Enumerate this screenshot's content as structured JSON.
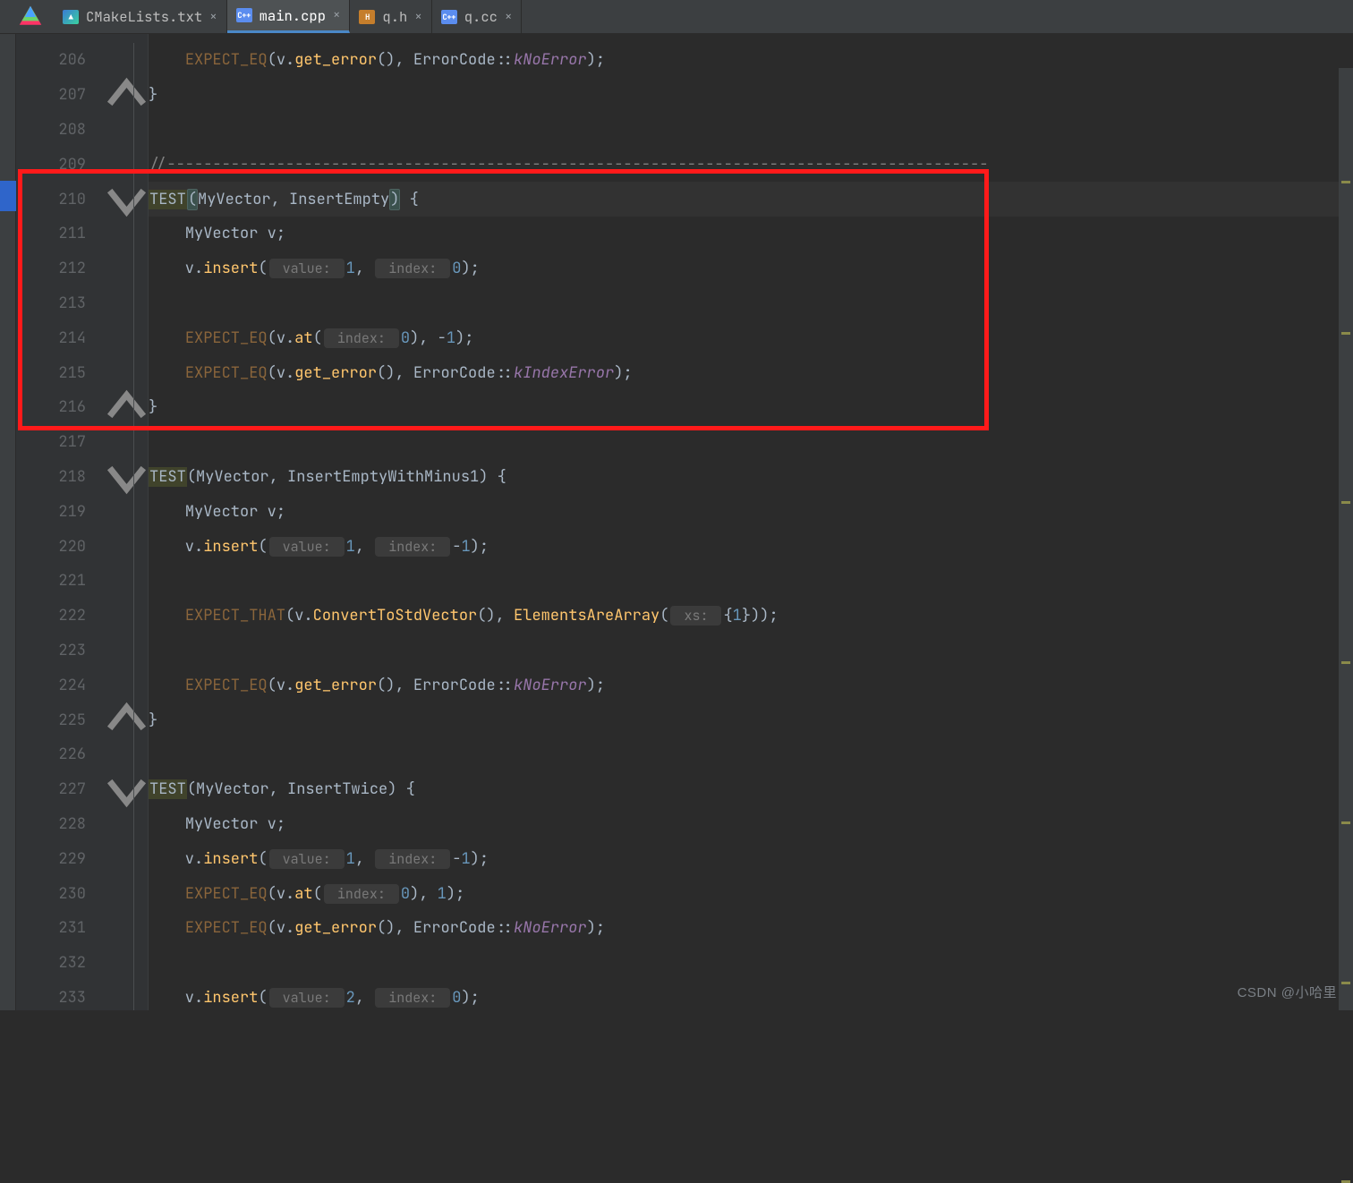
{
  "tabs": [
    {
      "label": "CMakeLists.txt",
      "ico": "cmake",
      "active": false
    },
    {
      "label": "main.cpp",
      "ico": "cpp",
      "active": true
    },
    {
      "label": "q.h",
      "ico": "h",
      "active": false
    },
    {
      "label": "q.cc",
      "ico": "cpp",
      "active": false
    }
  ],
  "first_line_no": 206,
  "code_lines": [
    {
      "n": 206,
      "fold": "",
      "run": false,
      "tokens": [
        [
          "    ",
          ""
        ],
        [
          "EXPECT_EQ",
          "mac"
        ],
        [
          "(v.",
          ""
        ],
        [
          "get_error",
          "fn"
        ],
        [
          "(), ",
          ""
        ],
        [
          "ErrorCode",
          "ns"
        ],
        [
          "::",
          ""
        ],
        [
          "kNoError",
          "enum"
        ],
        [
          ")",
          ""
        ],
        [
          ";",
          ""
        ]
      ]
    },
    {
      "n": 207,
      "fold": "close",
      "run": false,
      "tokens": [
        [
          "}",
          ""
        ]
      ]
    },
    {
      "n": 208,
      "fold": "",
      "run": false,
      "tokens": []
    },
    {
      "n": 209,
      "fold": "",
      "run": false,
      "tokens": [
        [
          "//------------------------------------------------------------------------------------------",
          "cmt"
        ]
      ]
    },
    {
      "n": 210,
      "fold": "open",
      "run": true,
      "tokens": [
        [
          "TEST",
          "test-hl"
        ],
        [
          "(",
          "caret-bracket"
        ],
        [
          "MyVector",
          "id"
        ],
        [
          ", ",
          ""
        ],
        [
          "InsertEmpty",
          "id"
        ],
        [
          ")",
          "caret-bracket"
        ],
        [
          " {",
          ""
        ]
      ]
    },
    {
      "n": 211,
      "fold": "",
      "run": false,
      "tokens": [
        [
          "    ",
          ""
        ],
        [
          "MyVector",
          "id"
        ],
        [
          " v",
          ""
        ],
        [
          ";",
          ""
        ]
      ]
    },
    {
      "n": 212,
      "fold": "",
      "run": false,
      "tokens": [
        [
          "    v.",
          ""
        ],
        [
          "insert",
          "fn"
        ],
        [
          "(",
          ""
        ],
        [
          " value: ",
          "hint"
        ],
        [
          "1",
          "num"
        ],
        [
          ", ",
          ""
        ],
        [
          " index: ",
          "hint"
        ],
        [
          "0",
          "num"
        ],
        [
          ")",
          ""
        ],
        [
          ";",
          ""
        ]
      ]
    },
    {
      "n": 213,
      "fold": "",
      "run": false,
      "tokens": []
    },
    {
      "n": 214,
      "fold": "",
      "run": false,
      "tokens": [
        [
          "    ",
          ""
        ],
        [
          "EXPECT_EQ",
          "mac"
        ],
        [
          "(v.",
          ""
        ],
        [
          "at",
          "fn"
        ],
        [
          "(",
          ""
        ],
        [
          " index: ",
          "hint"
        ],
        [
          "0",
          "num"
        ],
        [
          "), ",
          ""
        ],
        [
          "-",
          ""
        ],
        [
          "1",
          "num"
        ],
        [
          ")",
          ""
        ],
        [
          ";",
          ""
        ]
      ]
    },
    {
      "n": 215,
      "fold": "",
      "run": false,
      "tokens": [
        [
          "    ",
          ""
        ],
        [
          "EXPECT_EQ",
          "mac"
        ],
        [
          "(v.",
          ""
        ],
        [
          "get_error",
          "fn"
        ],
        [
          "(), ",
          ""
        ],
        [
          "ErrorCode",
          "ns"
        ],
        [
          "::",
          ""
        ],
        [
          "kIndexError",
          "enum"
        ],
        [
          ")",
          ""
        ],
        [
          ";",
          ""
        ]
      ]
    },
    {
      "n": 216,
      "fold": "close",
      "run": false,
      "tokens": [
        [
          "}",
          ""
        ]
      ]
    },
    {
      "n": 217,
      "fold": "",
      "run": false,
      "tokens": []
    },
    {
      "n": 218,
      "fold": "open",
      "run": true,
      "tokens": [
        [
          "TEST",
          "test-hl"
        ],
        [
          "(",
          ""
        ],
        [
          "MyVector",
          "id"
        ],
        [
          ", ",
          ""
        ],
        [
          "InsertEmptyWithMinus1",
          "id"
        ],
        [
          ") {",
          ""
        ]
      ]
    },
    {
      "n": 219,
      "fold": "",
      "run": false,
      "tokens": [
        [
          "    ",
          ""
        ],
        [
          "MyVector",
          "id"
        ],
        [
          " v",
          ""
        ],
        [
          ";",
          ""
        ]
      ]
    },
    {
      "n": 220,
      "fold": "",
      "run": false,
      "tokens": [
        [
          "    v.",
          ""
        ],
        [
          "insert",
          "fn"
        ],
        [
          "(",
          ""
        ],
        [
          " value: ",
          "hint"
        ],
        [
          "1",
          "num"
        ],
        [
          ", ",
          ""
        ],
        [
          " index: ",
          "hint"
        ],
        [
          "-",
          ""
        ],
        [
          "1",
          "num"
        ],
        [
          ")",
          ""
        ],
        [
          ";",
          ""
        ]
      ]
    },
    {
      "n": 221,
      "fold": "",
      "run": false,
      "tokens": []
    },
    {
      "n": 222,
      "fold": "",
      "run": false,
      "tokens": [
        [
          "    ",
          ""
        ],
        [
          "EXPECT_THAT",
          "mac"
        ],
        [
          "(v.",
          ""
        ],
        [
          "ConvertToStdVector",
          "fn"
        ],
        [
          "(), ",
          ""
        ],
        [
          "ElementsAreArray",
          "fn"
        ],
        [
          "(",
          ""
        ],
        [
          " xs: ",
          "hint"
        ],
        [
          "{",
          ""
        ],
        [
          "1",
          "num"
        ],
        [
          "}))",
          ""
        ],
        [
          ";",
          ""
        ]
      ]
    },
    {
      "n": 223,
      "fold": "",
      "run": false,
      "tokens": []
    },
    {
      "n": 224,
      "fold": "",
      "run": false,
      "tokens": [
        [
          "    ",
          ""
        ],
        [
          "EXPECT_EQ",
          "mac"
        ],
        [
          "(v.",
          ""
        ],
        [
          "get_error",
          "fn"
        ],
        [
          "(), ",
          ""
        ],
        [
          "ErrorCode",
          "ns"
        ],
        [
          "::",
          ""
        ],
        [
          "kNoError",
          "enum"
        ],
        [
          ")",
          ""
        ],
        [
          ";",
          ""
        ]
      ]
    },
    {
      "n": 225,
      "fold": "close",
      "run": false,
      "tokens": [
        [
          "}",
          ""
        ]
      ]
    },
    {
      "n": 226,
      "fold": "",
      "run": false,
      "tokens": []
    },
    {
      "n": 227,
      "fold": "open",
      "run": true,
      "tokens": [
        [
          "TEST",
          "test-hl"
        ],
        [
          "(",
          ""
        ],
        [
          "MyVector",
          "id"
        ],
        [
          ", ",
          ""
        ],
        [
          "InsertTwice",
          "id"
        ],
        [
          ") {",
          ""
        ]
      ]
    },
    {
      "n": 228,
      "fold": "",
      "run": false,
      "tokens": [
        [
          "    ",
          ""
        ],
        [
          "MyVector",
          "id"
        ],
        [
          " v",
          ""
        ],
        [
          ";",
          ""
        ]
      ]
    },
    {
      "n": 229,
      "fold": "",
      "run": false,
      "tokens": [
        [
          "    v.",
          ""
        ],
        [
          "insert",
          "fn"
        ],
        [
          "(",
          ""
        ],
        [
          " value: ",
          "hint"
        ],
        [
          "1",
          "num"
        ],
        [
          ", ",
          ""
        ],
        [
          " index: ",
          "hint"
        ],
        [
          "-",
          ""
        ],
        [
          "1",
          "num"
        ],
        [
          ")",
          ""
        ],
        [
          ";",
          ""
        ]
      ]
    },
    {
      "n": 230,
      "fold": "",
      "run": false,
      "tokens": [
        [
          "    ",
          ""
        ],
        [
          "EXPECT_EQ",
          "mac"
        ],
        [
          "(v.",
          ""
        ],
        [
          "at",
          "fn"
        ],
        [
          "(",
          ""
        ],
        [
          " index: ",
          "hint"
        ],
        [
          "0",
          "num"
        ],
        [
          "), ",
          ""
        ],
        [
          "1",
          "num"
        ],
        [
          ")",
          ""
        ],
        [
          ";",
          ""
        ]
      ]
    },
    {
      "n": 231,
      "fold": "",
      "run": false,
      "tokens": [
        [
          "    ",
          ""
        ],
        [
          "EXPECT_EQ",
          "mac"
        ],
        [
          "(v.",
          ""
        ],
        [
          "get_error",
          "fn"
        ],
        [
          "(), ",
          ""
        ],
        [
          "ErrorCode",
          "ns"
        ],
        [
          "::",
          ""
        ],
        [
          "kNoError",
          "enum"
        ],
        [
          ")",
          ""
        ],
        [
          ";",
          ""
        ]
      ]
    },
    {
      "n": 232,
      "fold": "",
      "run": false,
      "tokens": []
    },
    {
      "n": 233,
      "fold": "",
      "run": false,
      "tokens": [
        [
          "    v.",
          ""
        ],
        [
          "insert",
          "fn"
        ],
        [
          "(",
          ""
        ],
        [
          " value: ",
          "hint"
        ],
        [
          "2",
          "num"
        ],
        [
          ", ",
          ""
        ],
        [
          " index: ",
          "hint"
        ],
        [
          "0",
          "num"
        ],
        [
          ")",
          ""
        ],
        [
          ";",
          ""
        ]
      ]
    }
  ],
  "highlight_row_index": 4,
  "red_rect": {
    "top_row": 4,
    "bottom_row": 10
  },
  "watermark": "CSDN @小哈里",
  "scroll_markers": [
    12,
    28,
    46,
    63,
    80,
    97,
    118
  ]
}
